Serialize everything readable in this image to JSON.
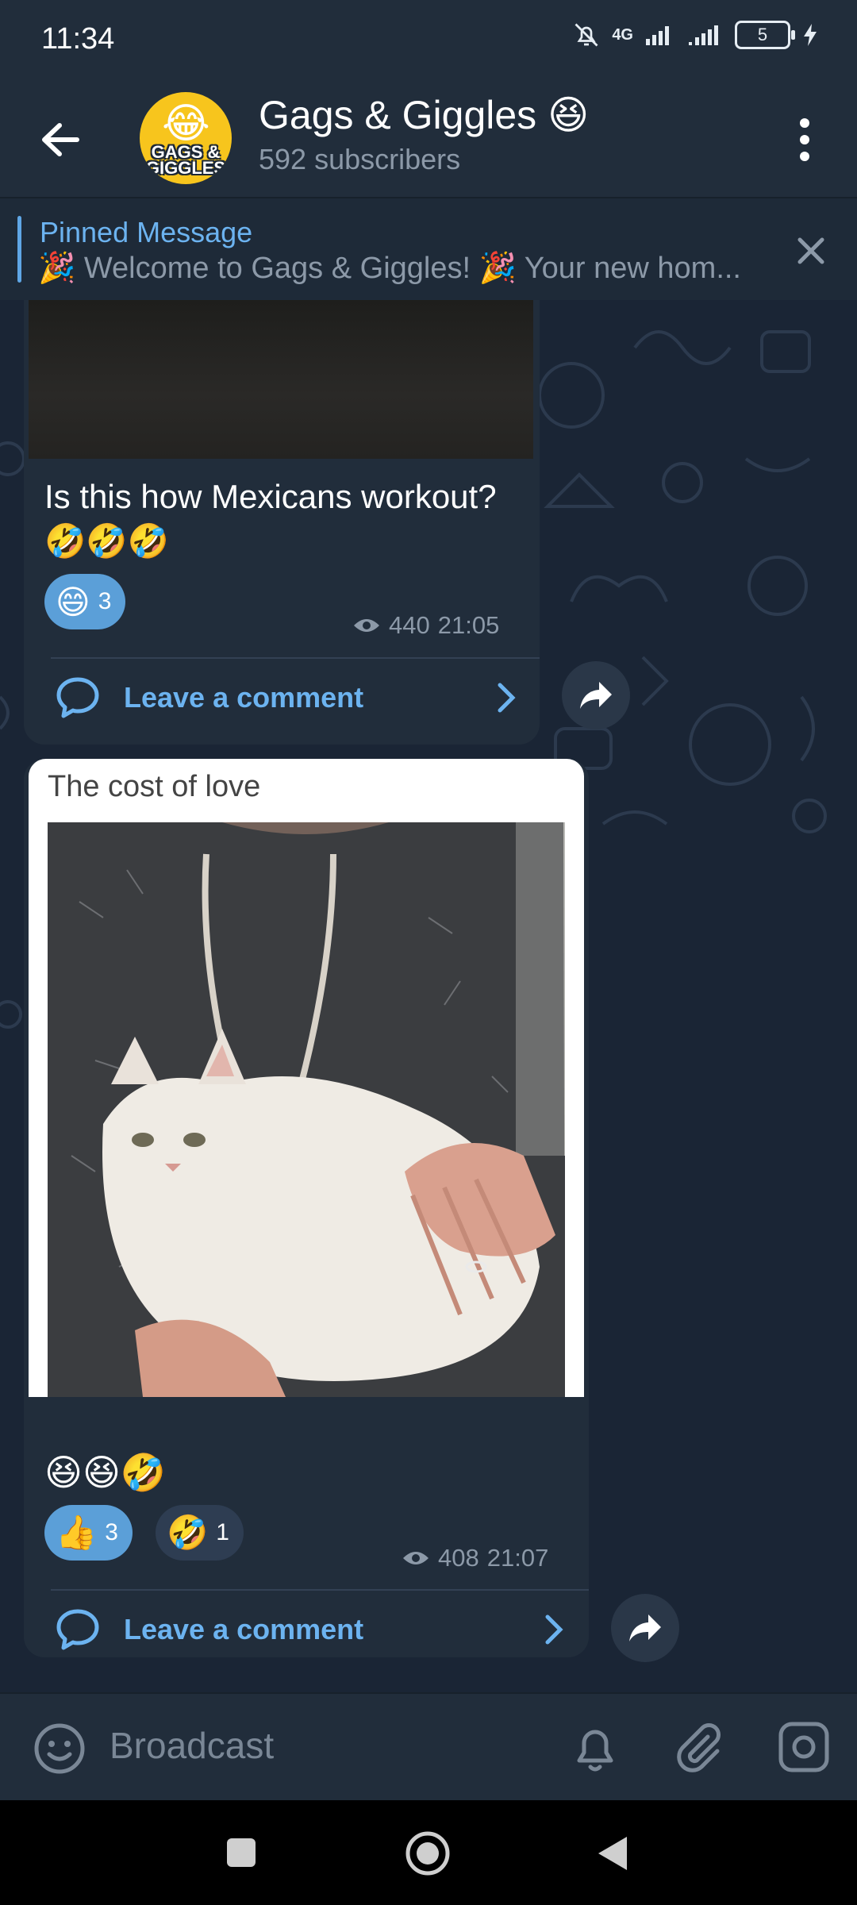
{
  "status_bar": {
    "time": "11:34",
    "network": "4G",
    "battery": "5"
  },
  "header": {
    "title": "Gags & Giggles 😆",
    "subtitle": "592 subscribers",
    "avatar_text": "GAGS & GIGGLES"
  },
  "pinned": {
    "title": "Pinned Message",
    "text": "🎉 Welcome to Gags & Giggles! 🎉  Your new hom..."
  },
  "messages": [
    {
      "text": "Is this how Mexicans workout? 🤣🤣🤣",
      "reactions": [
        {
          "emoji": "😄",
          "count": "3"
        }
      ],
      "views": "440",
      "time": "21:05",
      "comment_label": "Leave a comment"
    },
    {
      "caption": "The cost of love",
      "text": "😆😆🤣",
      "reactions": [
        {
          "emoji": "👍",
          "count": "3"
        },
        {
          "emoji": "🤣",
          "count": "1"
        }
      ],
      "views": "408",
      "time": "21:07",
      "comment_label": "Leave a comment"
    }
  ],
  "composer": {
    "placeholder": "Broadcast"
  },
  "colors": {
    "accent": "#6cb3f0",
    "bubble": "#212d3b",
    "header": "#212d3b",
    "background": "#1a2535"
  }
}
